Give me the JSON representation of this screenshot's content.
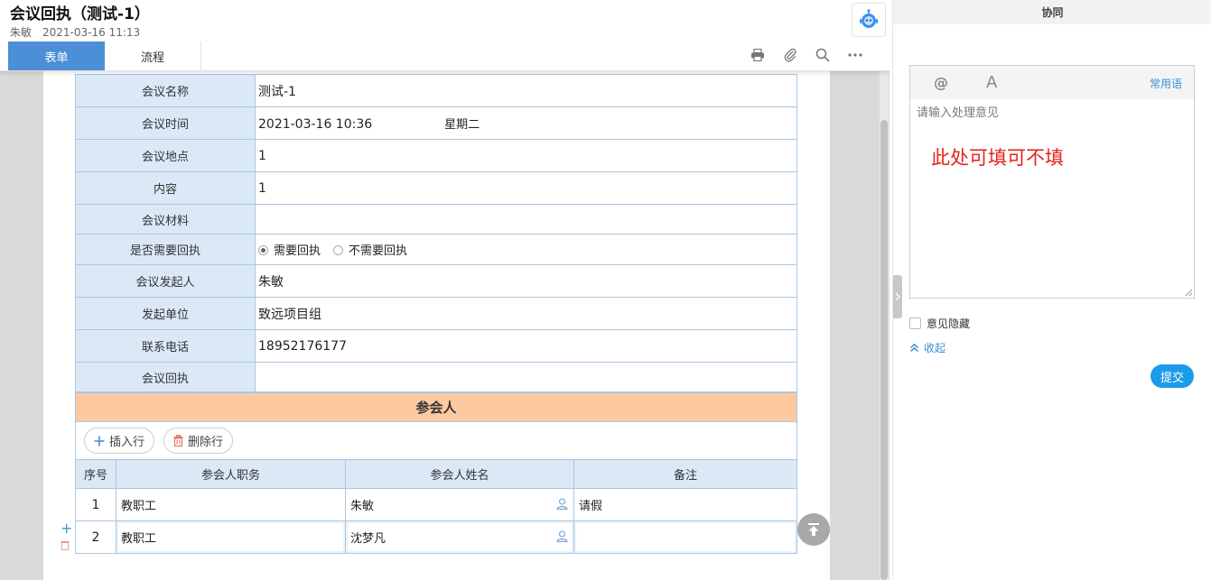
{
  "header": {
    "title": "会议回执（测试-1）",
    "author": "朱敏",
    "datetime": "2021-03-16 11:13"
  },
  "tabs": [
    {
      "label": "表单",
      "active": true
    },
    {
      "label": "流程",
      "active": false
    }
  ],
  "toolbar_icons": [
    "print-icon",
    "attachment-icon",
    "search-icon",
    "more-icon"
  ],
  "form": {
    "meeting_name": {
      "label": "会议名称",
      "value": "测试-1"
    },
    "meeting_time": {
      "label": "会议时间",
      "value": "2021-03-16 10:36",
      "weekday": "星期二"
    },
    "meeting_place": {
      "label": "会议地点",
      "value": "1"
    },
    "content": {
      "label": "内容",
      "value": "1"
    },
    "materials": {
      "label": "会议材料",
      "value": ""
    },
    "need_receipt": {
      "label": "是否需要回执",
      "options": [
        "需要回执",
        "不需要回执"
      ],
      "selected": "需要回执"
    },
    "initiator": {
      "label": "会议发起人",
      "value": "朱敏"
    },
    "unit": {
      "label": "发起单位",
      "value": "致远项目组"
    },
    "phone": {
      "label": "联系电话",
      "value": "18952176177"
    },
    "receipt": {
      "label": "会议回执",
      "value": ""
    }
  },
  "attendees": {
    "section_title": "参会人",
    "insert_label": "插入行",
    "delete_label": "删除行",
    "columns": [
      "序号",
      "参会人职务",
      "参会人姓名",
      "备注"
    ],
    "rows": [
      {
        "index": "1",
        "position": "教职工",
        "name": "朱敏",
        "note": "请假"
      },
      {
        "index": "2",
        "position": "教职工",
        "name": "沈梦凡",
        "note": ""
      }
    ]
  },
  "side_panel": {
    "title": "协同",
    "common_phrases": "常用语",
    "placeholder": "请输入处理意见",
    "hint": "此处可填可不填",
    "hide_opinion": "意见隐藏",
    "collapse": "收起",
    "submit": "提交"
  },
  "colors": {
    "accent": "#4c8fd6",
    "section_header": "#fdc9a0",
    "label_bg": "#dbe9f7",
    "submit": "#1b9cea",
    "hint": "#e2231a"
  }
}
